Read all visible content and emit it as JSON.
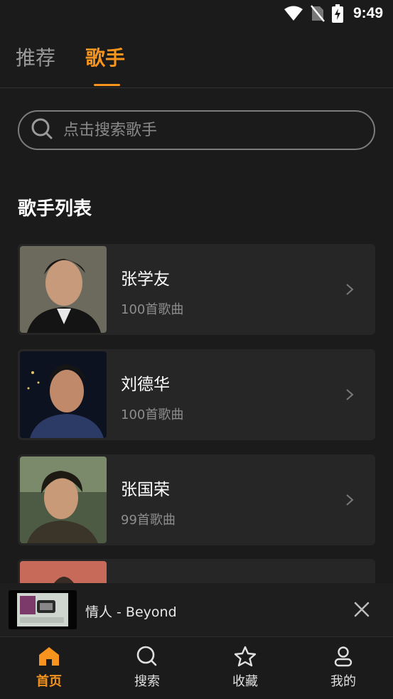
{
  "status_bar": {
    "time": "9:49",
    "icons": [
      "wifi-icon",
      "no-sim-icon",
      "battery-charging-icon"
    ]
  },
  "tabs": [
    {
      "label": "推荐",
      "active": false
    },
    {
      "label": "歌手",
      "active": true
    }
  ],
  "search": {
    "placeholder": "点击搜索歌手",
    "value": "",
    "icon": "search-icon"
  },
  "section_title": "歌手列表",
  "singers": [
    {
      "name": "张学友",
      "count": "100首歌曲"
    },
    {
      "name": "刘德华",
      "count": "100首歌曲"
    },
    {
      "name": "张国荣",
      "count": "99首歌曲"
    },
    {
      "name": "",
      "count": ""
    }
  ],
  "mini_player": {
    "title": "情人 - Beyond",
    "close_icon": "close-icon"
  },
  "bottom_nav": [
    {
      "label": "首页",
      "icon": "home-icon",
      "active": true
    },
    {
      "label": "搜索",
      "icon": "search-icon",
      "active": false
    },
    {
      "label": "收藏",
      "icon": "star-icon",
      "active": false
    },
    {
      "label": "我的",
      "icon": "user-icon",
      "active": false
    }
  ],
  "colors": {
    "accent": "#f7941d",
    "background": "#1b1b1b",
    "card": "#262626",
    "muted": "#8d8d8d"
  }
}
